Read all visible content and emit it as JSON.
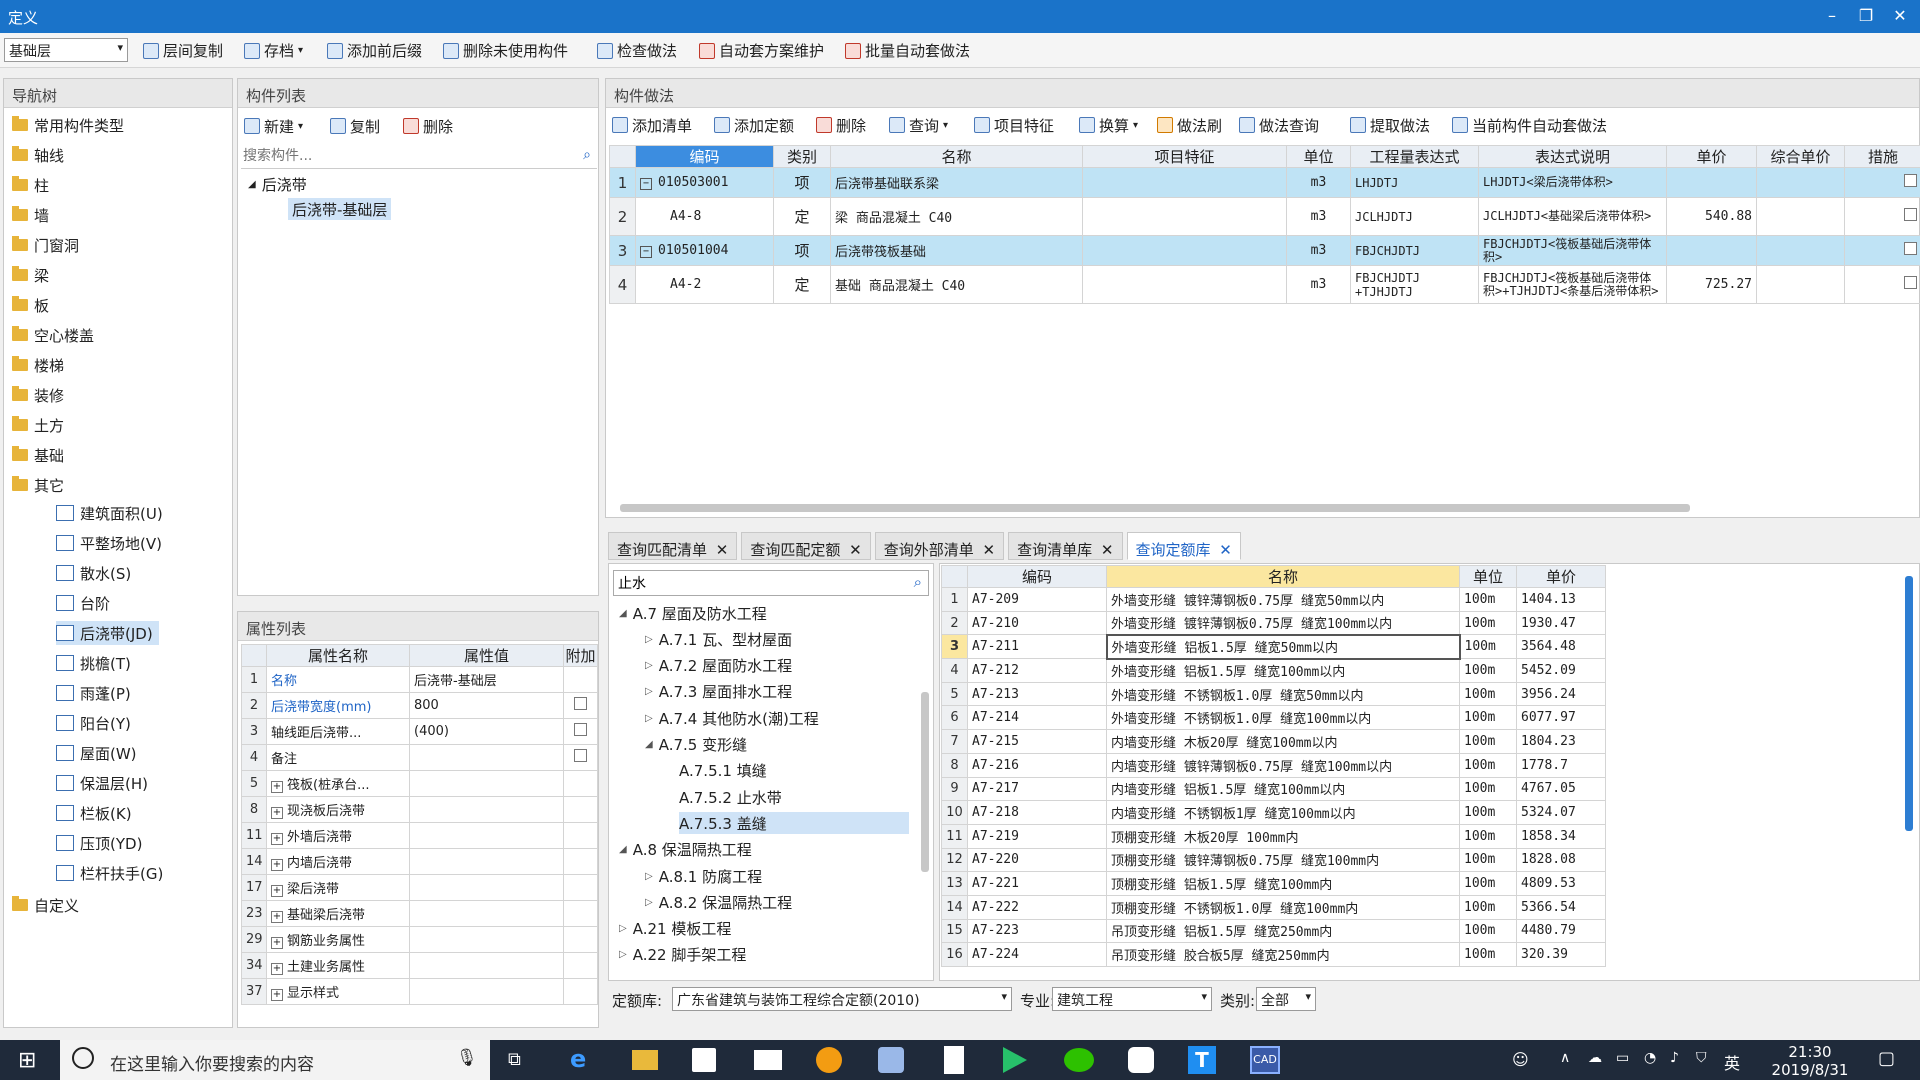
{
  "window": {
    "title": "定义",
    "min": "–",
    "restore": "❐",
    "close": "✕"
  },
  "toolbar": {
    "floor_select": "基础层",
    "items": [
      "层间复制",
      "存档",
      "添加前后缀",
      "删除未使用构件",
      "检查做法",
      "自动套方案维护",
      "批量自动套做法"
    ]
  },
  "nav": {
    "title": "导航树",
    "folders": [
      "常用构件类型",
      "轴线",
      "柱",
      "墙",
      "门窗洞",
      "梁",
      "板",
      "空心楼盖",
      "楼梯",
      "装修",
      "土方",
      "基础",
      "其它"
    ],
    "others": [
      "建筑面积(U)",
      "平整场地(V)",
      "散水(S)",
      "台阶",
      "后浇带(JD)",
      "挑檐(T)",
      "雨蓬(P)",
      "阳台(Y)",
      "屋面(W)",
      "保温层(H)",
      "栏板(K)",
      "压顶(YD)",
      "栏杆扶手(G)"
    ],
    "last": "自定义"
  },
  "complist": {
    "title": "构件列表",
    "new": "新建",
    "copy": "复制",
    "delete": "删除",
    "search_placeholder": "搜索构件...",
    "parent": "后浇带",
    "child": "后浇带-基础层"
  },
  "props": {
    "title": "属性列表",
    "headers": [
      "属性名称",
      "属性值",
      "附加"
    ],
    "rows": [
      {
        "n": "1",
        "name": "名称",
        "value": "后浇带-基础层",
        "cb": false,
        "blue": true
      },
      {
        "n": "2",
        "name": "后浇带宽度(mm)",
        "value": "800",
        "cb": true,
        "blue": true
      },
      {
        "n": "3",
        "name": "轴线距后浇带...",
        "value": "(400)",
        "cb": true,
        "blue": false
      },
      {
        "n": "4",
        "name": "备注",
        "value": "",
        "cb": true,
        "blue": false
      },
      {
        "n": "5",
        "name": "筏板(桩承台...",
        "value": "",
        "cb": false,
        "plus": true
      },
      {
        "n": "8",
        "name": "现浇板后浇带",
        "value": "",
        "cb": false,
        "plus": true
      },
      {
        "n": "11",
        "name": "外墙后浇带",
        "value": "",
        "cb": false,
        "plus": true
      },
      {
        "n": "14",
        "name": "内墙后浇带",
        "value": "",
        "cb": false,
        "plus": true
      },
      {
        "n": "17",
        "name": "梁后浇带",
        "value": "",
        "cb": false,
        "plus": true
      },
      {
        "n": "23",
        "name": "基础梁后浇带",
        "value": "",
        "cb": false,
        "plus": true
      },
      {
        "n": "29",
        "name": "钢筋业务属性",
        "value": "",
        "cb": false,
        "plus": true
      },
      {
        "n": "34",
        "name": "土建业务属性",
        "value": "",
        "cb": false,
        "plus": true
      },
      {
        "n": "37",
        "name": "显示样式",
        "value": "",
        "cb": false,
        "plus": true
      }
    ]
  },
  "method": {
    "title": "构件做法",
    "tools": [
      "添加清单",
      "添加定额",
      "删除",
      "查询",
      "项目特征",
      "换算",
      "做法刷",
      "做法查询",
      "提取做法",
      "当前构件自动套做法"
    ],
    "headers": [
      "编码",
      "类别",
      "名称",
      "项目特征",
      "单位",
      "工程量表达式",
      "表达式说明",
      "单价",
      "综合单价",
      "措施"
    ],
    "rows": [
      {
        "n": "1",
        "code": "010503001",
        "type": "项",
        "name": "后浇带基础联系梁",
        "feat": "",
        "unit": "m3",
        "expr": "LHJDTJ",
        "desc": "LHJDTJ<梁后浇带体积>",
        "price": "",
        "hl": true,
        "minus": true
      },
      {
        "n": "2",
        "code": "A4-8",
        "type": "定",
        "name": "梁 商品混凝土 C40",
        "feat": "",
        "unit": "m3",
        "expr": "JCLHJDTJ",
        "desc": "JCLHJDTJ<基础梁后浇带体积>",
        "price": "540.88",
        "hl": false,
        "minus": false
      },
      {
        "n": "3",
        "code": "010501004",
        "type": "项",
        "name": "后浇带筏板基础",
        "feat": "",
        "unit": "m3",
        "expr": "FBJCHJDTJ",
        "desc": "FBJCHJDTJ<筏板基础后浇带体积>",
        "price": "",
        "hl": true,
        "minus": true
      },
      {
        "n": "4",
        "code": "A4-2",
        "type": "定",
        "name": "基础 商品混凝土 C40",
        "feat": "",
        "unit": "m3",
        "expr": "FBJCHJDTJ +TJHJDTJ",
        "desc": "FBJCHJDTJ<筏板基础后浇带体积>+TJHJDTJ<条基后浇带体积>",
        "price": "725.27",
        "hl": false,
        "minus": false
      }
    ]
  },
  "bottom": {
    "tabs": [
      "查询匹配清单",
      "查询匹配定额",
      "查询外部清单",
      "查询清单库",
      "查询定额库"
    ],
    "search_value": "止水",
    "tree": [
      {
        "t": "A.7 屋面及防水工程",
        "lvl": 0,
        "exp": "◢"
      },
      {
        "t": "A.7.1 瓦、型材屋面",
        "lvl": 1,
        "exp": "▷"
      },
      {
        "t": "A.7.2 屋面防水工程",
        "lvl": 1,
        "exp": "▷"
      },
      {
        "t": "A.7.3 屋面排水工程",
        "lvl": 1,
        "exp": "▷"
      },
      {
        "t": "A.7.4 其他防水(潮)工程",
        "lvl": 1,
        "exp": "▷"
      },
      {
        "t": "A.7.5 变形缝",
        "lvl": 1,
        "exp": "◢"
      },
      {
        "t": "A.7.5.1 填缝",
        "lvl": 2,
        "exp": ""
      },
      {
        "t": "A.7.5.2 止水带",
        "lvl": 2,
        "exp": ""
      },
      {
        "t": "A.7.5.3 盖缝",
        "lvl": 2,
        "exp": "",
        "sel": true
      },
      {
        "t": "A.8 保温隔热工程",
        "lvl": 0,
        "exp": "◢"
      },
      {
        "t": "A.8.1 防腐工程",
        "lvl": 1,
        "exp": "▷"
      },
      {
        "t": "A.8.2 保温隔热工程",
        "lvl": 1,
        "exp": "▷"
      },
      {
        "t": "A.21 模板工程",
        "lvl": 0,
        "exp": "▷"
      },
      {
        "t": "A.22 脚手架工程",
        "lvl": 0,
        "exp": "▷"
      }
    ],
    "headers": [
      "编码",
      "名称",
      "单位",
      "单价"
    ],
    "rows": [
      [
        "1",
        "A7-209",
        "外墙变形缝 镀锌薄钢板0.75厚 缝宽50mm以内",
        "100m",
        "1404.13"
      ],
      [
        "2",
        "A7-210",
        "外墙变形缝 镀锌薄钢板0.75厚 缝宽100mm以内",
        "100m",
        "1930.47"
      ],
      [
        "3",
        "A7-211",
        "外墙变形缝 铝板1.5厚 缝宽50mm以内",
        "100m",
        "3564.48"
      ],
      [
        "4",
        "A7-212",
        "外墙变形缝 铝板1.5厚 缝宽100mm以内",
        "100m",
        "5452.09"
      ],
      [
        "5",
        "A7-213",
        "外墙变形缝 不锈钢板1.0厚 缝宽50mm以内",
        "100m",
        "3956.24"
      ],
      [
        "6",
        "A7-214",
        "外墙变形缝 不锈钢板1.0厚 缝宽100mm以内",
        "100m",
        "6077.97"
      ],
      [
        "7",
        "A7-215",
        "内墙变形缝 木板20厚 缝宽100mm以内",
        "100m",
        "1804.23"
      ],
      [
        "8",
        "A7-216",
        "内墙变形缝 镀锌薄钢板0.75厚 缝宽100mm以内",
        "100m",
        "1778.7"
      ],
      [
        "9",
        "A7-217",
        "内墙变形缝 铝板1.5厚 缝宽100mm以内",
        "100m",
        "4767.05"
      ],
      [
        "10",
        "A7-218",
        "内墙变形缝 不锈钢板1厚 缝宽100mm以内",
        "100m",
        "5324.07"
      ],
      [
        "11",
        "A7-219",
        "顶棚变形缝 木板20厚 100mm内",
        "100m",
        "1858.34"
      ],
      [
        "12",
        "A7-220",
        "顶棚变形缝 镀锌薄钢板0.75厚 缝宽100mm内",
        "100m",
        "1828.08"
      ],
      [
        "13",
        "A7-221",
        "顶棚变形缝 铝板1.5厚 缝宽100mm内",
        "100m",
        "4809.53"
      ],
      [
        "14",
        "A7-222",
        "顶棚变形缝 不锈钢板1.0厚 缝宽100mm内",
        "100m",
        "5366.54"
      ],
      [
        "15",
        "A7-223",
        "吊顶变形缝 铝板1.5厚 缝宽250mm内",
        "100m",
        "4480.79"
      ],
      [
        "16",
        "A7-224",
        "吊顶变形缝 胶合板5厚 缝宽250mm内",
        "100m",
        "320.39"
      ]
    ],
    "quota_label": "定额库:",
    "quota_value": "广东省建筑与装饰工程综合定额(2010)",
    "major_label": "专业:",
    "major_value": "建筑工程",
    "cat_label": "类别:",
    "cat_value": "全部"
  },
  "taskbar": {
    "search": "在这里输入你要搜索的内容",
    "ime": "英",
    "time": "21:30",
    "date": "2019/8/31"
  }
}
